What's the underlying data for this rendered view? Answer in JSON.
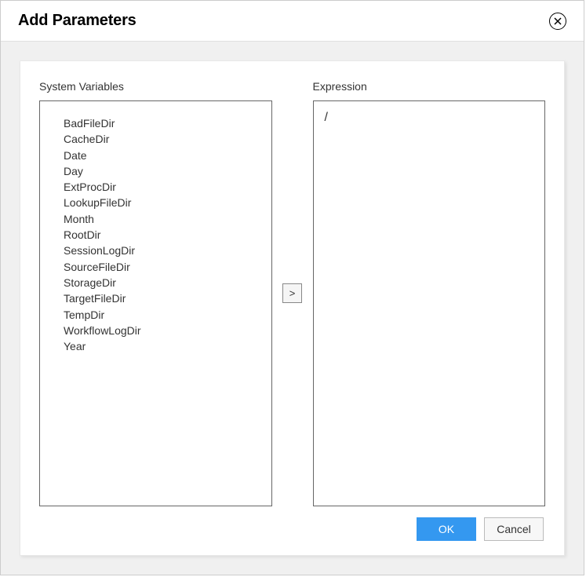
{
  "dialog": {
    "title": "Add Parameters"
  },
  "left": {
    "label": "System Variables",
    "items": [
      "BadFileDir",
      "CacheDir",
      "Date",
      "Day",
      "ExtProcDir",
      "LookupFileDir",
      "Month",
      "RootDir",
      "SessionLogDir",
      "SourceFileDir",
      "StorageDir",
      "TargetFileDir",
      "TempDir",
      "WorkflowLogDir",
      "Year"
    ]
  },
  "transfer": {
    "label": ">"
  },
  "right": {
    "label": "Expression",
    "value": "/"
  },
  "buttons": {
    "ok": "OK",
    "cancel": "Cancel"
  }
}
